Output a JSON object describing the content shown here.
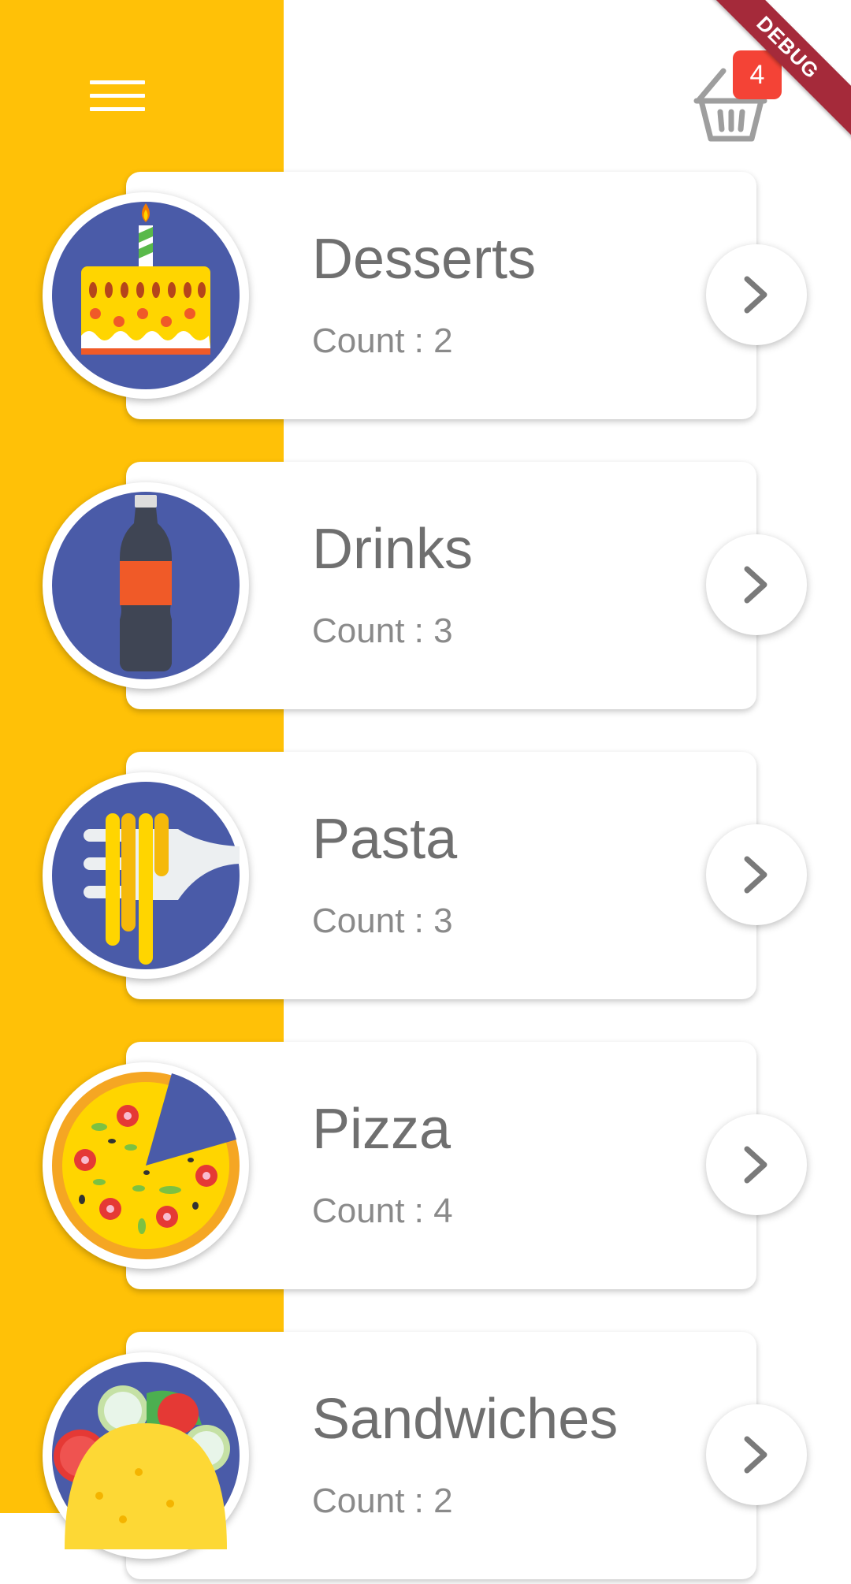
{
  "app": {
    "accent_color": "#FFC107",
    "debug_banner": "DEBUG"
  },
  "header": {
    "menu_icon": "hamburger-menu-icon",
    "cart_icon": "basket-icon",
    "cart_count": "4"
  },
  "categories": [
    {
      "name": "Desserts",
      "count_label": "Count : 2",
      "icon": "cake-icon"
    },
    {
      "name": "Drinks",
      "count_label": "Count : 3",
      "icon": "soda-bottle-icon"
    },
    {
      "name": "Pasta",
      "count_label": "Count : 3",
      "icon": "pasta-fork-icon"
    },
    {
      "name": "Pizza",
      "count_label": "Count : 4",
      "icon": "pizza-icon"
    },
    {
      "name": "Sandwiches",
      "count_label": "Count : 2",
      "icon": "taco-icon"
    }
  ]
}
